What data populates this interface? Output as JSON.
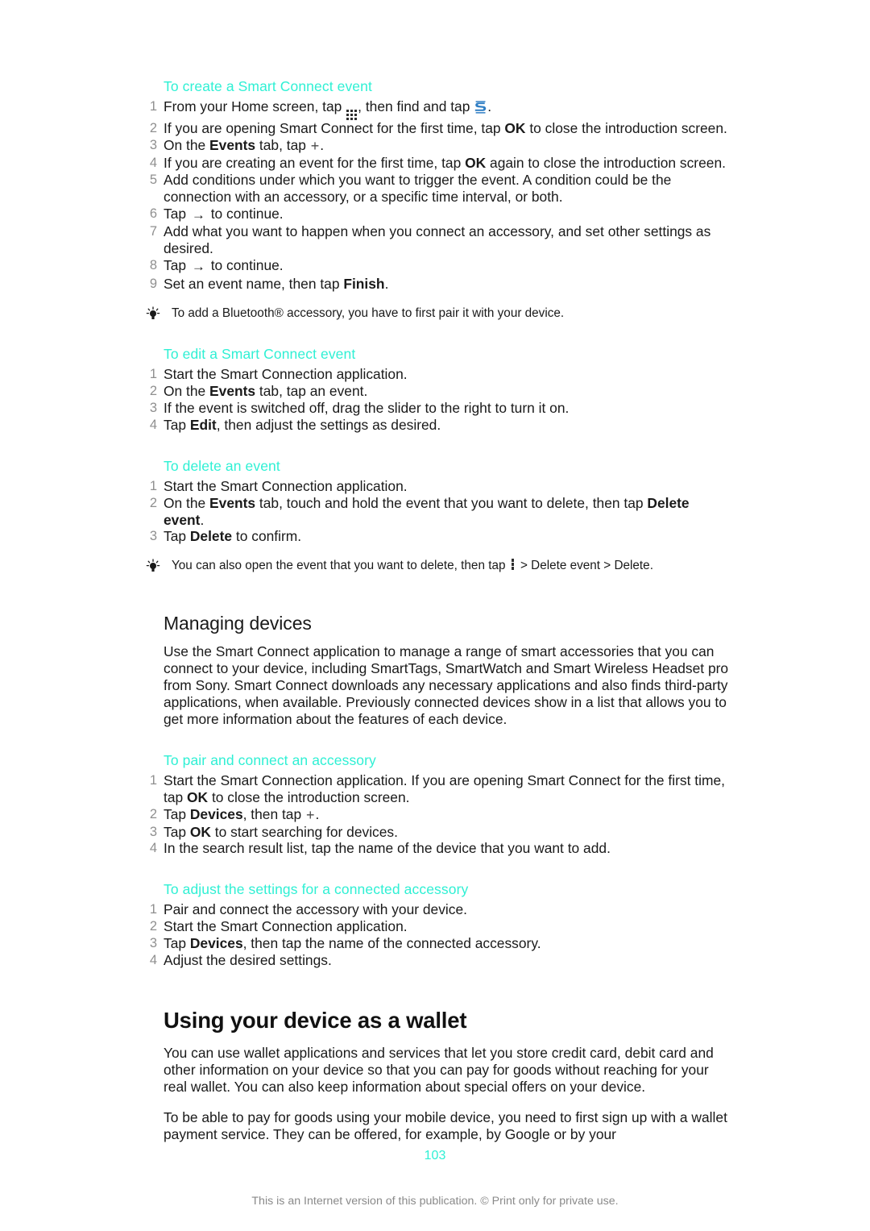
{
  "document": {
    "page_number": "103",
    "footer_note": "This is an Internet version of this publication. © Print only for private use.",
    "accent_color": "#2ff0d4",
    "text_color": "#1a1a1a",
    "number_color": "#8f8f8f"
  },
  "sections": {
    "create_event": {
      "heading": "To create a Smart Connect event",
      "steps": {
        "s1_a": "From your Home screen, tap ",
        "s1_b": ", then find and tap ",
        "s1_c": ".",
        "s2_a": "If you are opening Smart Connect for the first time, tap ",
        "s2_b": "OK",
        "s2_c": " to close the introduction screen.",
        "s3_a": "On the ",
        "s3_b": "Events",
        "s3_c": " tab, tap ",
        "s3_d": ".",
        "s4_a": "If you are creating an event for the first time, tap ",
        "s4_b": "OK",
        "s4_c": " again to close the introduction screen.",
        "s5": "Add conditions under which you want to trigger the event. A condition could be the connection with an accessory, or a specific time interval, or both.",
        "s6_a": "Tap ",
        "s6_b": " to continue.",
        "s7": "Add what you want to happen when you connect an accessory, and set other settings as desired.",
        "s8_a": "Tap ",
        "s8_b": " to continue.",
        "s9_a": "Set an event name, then tap ",
        "s9_b": "Finish",
        "s9_c": "."
      },
      "tip": "To add a Bluetooth® accessory, you have to first pair it with your device."
    },
    "edit_event": {
      "heading": "To edit a Smart Connect event",
      "steps": {
        "s1": "Start the Smart Connection application.",
        "s2_a": "On the ",
        "s2_b": "Events",
        "s2_c": " tab, tap an event.",
        "s3": "If the event is switched off, drag the slider to the right to turn it on.",
        "s4_a": "Tap ",
        "s4_b": "Edit",
        "s4_c": ", then adjust the settings as desired."
      }
    },
    "delete_event": {
      "heading": "To delete an event",
      "steps": {
        "s1": "Start the Smart Connection application.",
        "s2_a": "On the ",
        "s2_b": "Events",
        "s2_c": " tab, touch and hold the event that you want to delete, then tap ",
        "s2_d": "Delete event",
        "s2_e": ".",
        "s3_a": "Tap ",
        "s3_b": "Delete",
        "s3_c": " to confirm."
      },
      "tip_a": "You can also open the event that you want to delete, then tap ",
      "tip_b": " > Delete event > Delete."
    },
    "managing_devices": {
      "heading": "Managing devices",
      "paragraph": "Use the Smart Connect application to manage a range of smart accessories that you can connect to your device, including SmartTags, SmartWatch and Smart Wireless Headset pro from Sony. Smart Connect downloads any necessary applications and also finds third-party applications, when available. Previously connected devices show in a list that allows you to get more information about the features of each device."
    },
    "pair_accessory": {
      "heading": "To pair and connect an accessory",
      "steps": {
        "s1_a": "Start the Smart Connection application. If you are opening Smart Connect for the first time, tap ",
        "s1_b": "OK",
        "s1_c": " to close the introduction screen.",
        "s2_a": "Tap ",
        "s2_b": "Devices",
        "s2_c": ", then tap ",
        "s2_d": ".",
        "s3_a": "Tap ",
        "s3_b": "OK",
        "s3_c": " to start searching for devices.",
        "s4": "In the search result list, tap the name of the device that you want to add."
      }
    },
    "adjust_settings": {
      "heading": "To adjust the settings for a connected accessory",
      "steps": {
        "s1": "Pair and connect the accessory with your device.",
        "s2": "Start the Smart Connection application.",
        "s3_a": "Tap ",
        "s3_b": "Devices",
        "s3_c": ", then tap the name of the connected accessory.",
        "s4": "Adjust the desired settings."
      }
    },
    "wallet": {
      "heading": "Using your device as a wallet",
      "paragraph_1": "You can use wallet applications and services that let you store credit card, debit card and other information on your device so that you can pay for goods without reaching for your real wallet. You can also keep information about special offers on your device.",
      "paragraph_2": "To be able to pay for goods using your mobile device, you need to first sign up with a wallet payment service. They can be offered, for example, by Google or by your"
    }
  },
  "icons": {
    "app_grid": "app-grid-icon",
    "smart_connect": "smart-connect-icon",
    "arrow_right": "→",
    "plus": "+",
    "overflow_menu": "vertical-dots-icon",
    "tip_bulb": "lightbulb-icon"
  }
}
